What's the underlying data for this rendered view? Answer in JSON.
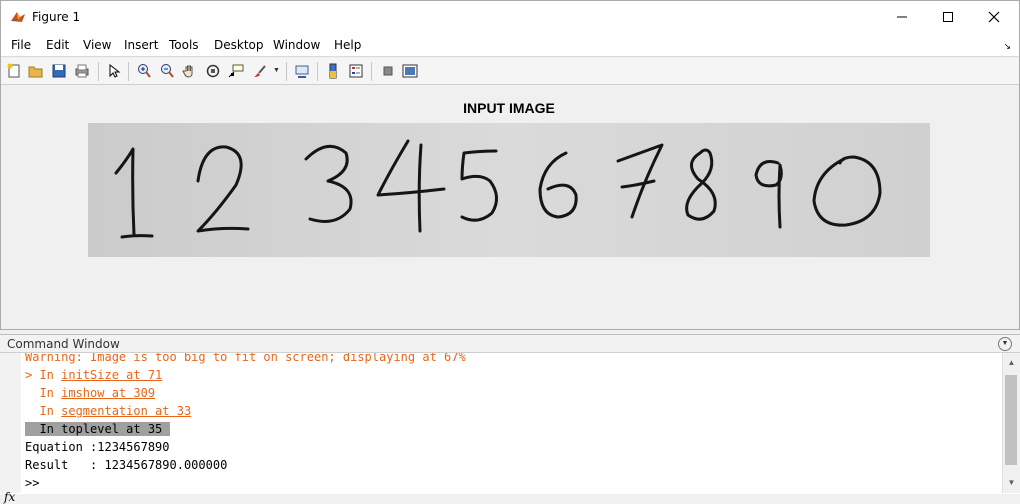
{
  "window": {
    "title": "Figure 1",
    "controls": [
      "minimize",
      "maximize",
      "close"
    ]
  },
  "menu": [
    "File",
    "Edit",
    "View",
    "Insert",
    "Tools",
    "Desktop",
    "Window",
    "Help"
  ],
  "toolbar": {
    "icons": [
      "new-figure-icon",
      "open-file-icon",
      "save-icon",
      "print-icon",
      "edit-plot-icon",
      "zoom-in-icon",
      "zoom-out-icon",
      "pan-icon",
      "rotate-3d-icon",
      "data-cursor-icon",
      "brush-icon",
      "link-plot-icon",
      "insert-colorbar-icon",
      "insert-legend-icon",
      "hide-plot-tools-icon",
      "show-plot-tools-icon"
    ]
  },
  "figure": {
    "axes_title": "INPUT IMAGE",
    "image_digits": [
      "1",
      "2",
      "3",
      "4",
      "5",
      "6",
      "7",
      "8",
      "9",
      "0"
    ]
  },
  "command_window": {
    "title": "Command Window",
    "lines": {
      "warning": "Warning: Image is too big to fit on screen; displaying at 67%",
      "l1_prefix": "> In ",
      "l1_link": "initSize at 71",
      "l2_prefix": "  In ",
      "l2_link": "imshow at 309",
      "l3_prefix": "  In ",
      "l3_link": "segmentation at 33",
      "l4": "  In toplevel at 35",
      "equation": "Equation :1234567890",
      "result": "Result   : 1234567890.000000",
      "prompt": ">>"
    },
    "fx_label": "fx"
  },
  "colors": {
    "warning": "#e8661a",
    "highlight": "#a0a0a0"
  }
}
